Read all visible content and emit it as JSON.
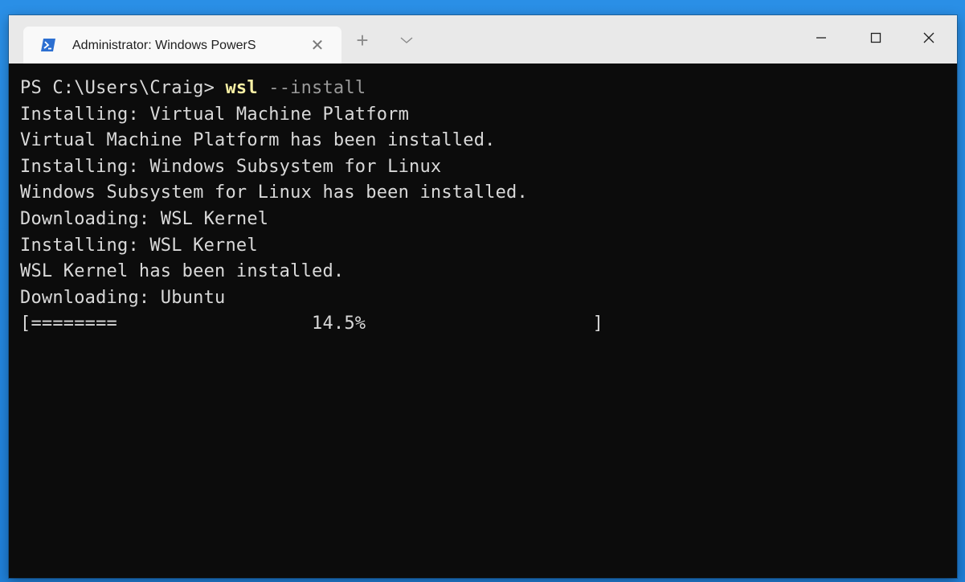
{
  "window": {
    "tab_title": "Administrator: Windows PowerS",
    "tab_close_glyph": "✕",
    "new_tab_glyph": "+",
    "icons": {
      "tab": "powershell-icon",
      "close_tab": "close-icon",
      "new_tab": "plus-icon",
      "dropdown": "chevron-down-icon",
      "minimize": "minimize-icon",
      "maximize": "maximize-icon",
      "close": "close-icon"
    }
  },
  "terminal": {
    "prompt": "PS C:\\Users\\Craig> ",
    "command": "wsl",
    "argument": " --install",
    "output": [
      "Installing: Virtual Machine Platform",
      "Virtual Machine Platform has been installed.",
      "Installing: Windows Subsystem for Linux",
      "Windows Subsystem for Linux has been installed.",
      "Downloading: WSL Kernel",
      "Installing: WSL Kernel",
      "WSL Kernel has been installed.",
      "Downloading: Ubuntu"
    ],
    "progress_line": "[========                  14.5%                     ]",
    "progress_percent": 14.5
  },
  "colors": {
    "terminal_bg": "#0c0c0c",
    "terminal_fg": "#d9d9d9",
    "command": "#f9f1a5",
    "argument": "#9a9a9a",
    "titlebar": "#e9e9e9",
    "desktop": "#1f7fd8"
  }
}
